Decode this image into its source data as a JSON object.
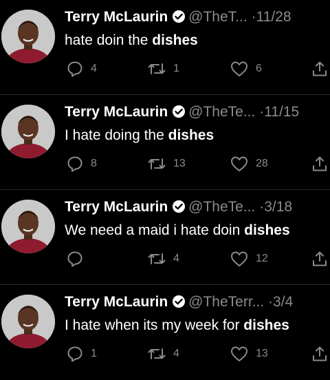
{
  "colors": {
    "background": "#000000",
    "muted": "#8b8b8b",
    "text": "#ffffff"
  },
  "icons": [
    "verified-badge-icon",
    "reply-icon",
    "retweet-icon",
    "like-icon",
    "share-icon"
  ],
  "tweets": [
    {
      "name": "Terry McLaurin",
      "handle": "@TheT...",
      "dot": "·",
      "date": "11/28",
      "text_before": "hate doin the ",
      "text_bold": "dishes",
      "text_after": "",
      "replies": "4",
      "retweets": "1",
      "likes": "6"
    },
    {
      "name": "Terry McLaurin",
      "handle": "@TheTe...",
      "dot": "·",
      "date": "11/15",
      "text_before": "I hate doing the ",
      "text_bold": "dishes",
      "text_after": "",
      "replies": "8",
      "retweets": "13",
      "likes": "28"
    },
    {
      "name": "Terry McLaurin",
      "handle": "@TheTe...",
      "dot": "·",
      "date": "3/18",
      "text_before": "We need a maid i hate doin ",
      "text_bold": "dishes",
      "text_after": "",
      "replies": "",
      "retweets": "4",
      "likes": "12"
    },
    {
      "name": "Terry McLaurin",
      "handle": "@TheTerr...",
      "dot": "·",
      "date": "3/4",
      "text_before": "I hate when its my week for ",
      "text_bold": "dishes",
      "text_after": "",
      "replies": "1",
      "retweets": "4",
      "likes": "13"
    }
  ]
}
